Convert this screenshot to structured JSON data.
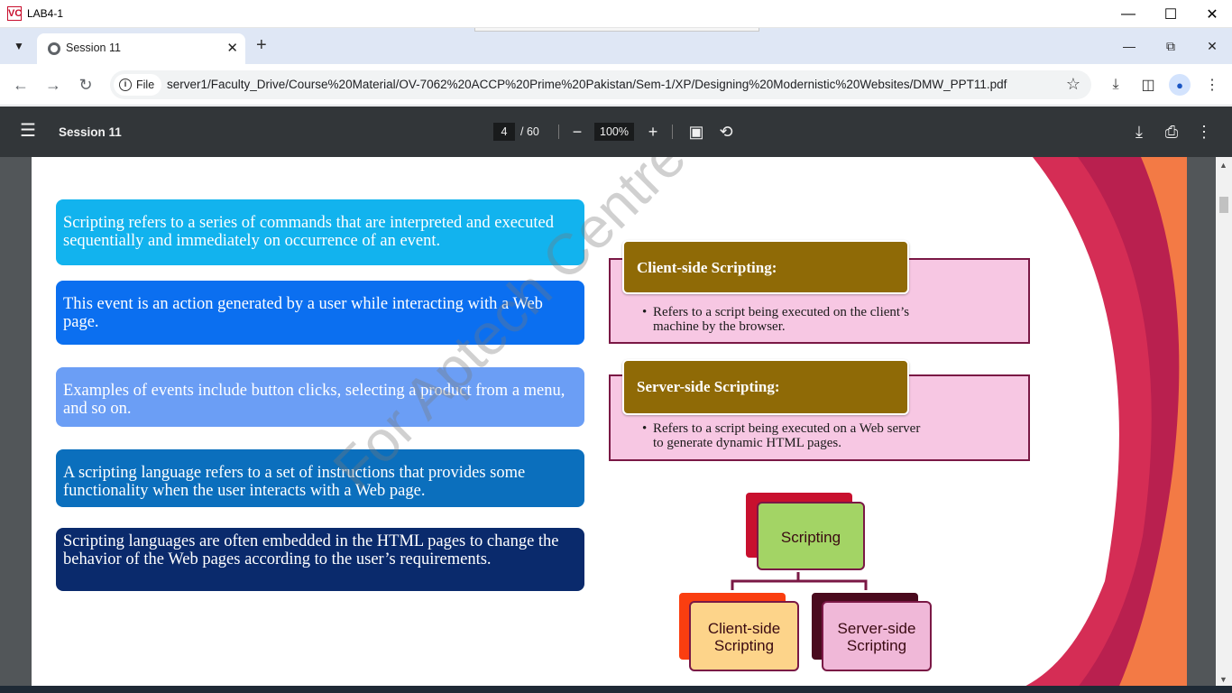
{
  "window": {
    "title": "LAB4-1",
    "logo_text": "VC"
  },
  "browser": {
    "tab_title": "Session 11",
    "url_chip": "File",
    "url": "server1/Faculty_Drive/Course%20Material/OV-7062%20ACCP%20Prime%20Pakistan/Sem-1/XP/Designing%20Modernistic%20Websites/DMW_PPT11.pdf"
  },
  "pdf_toolbar": {
    "title": "Session 11",
    "page_current": "4",
    "page_total": "/ 60",
    "zoom": "100%"
  },
  "slide": {
    "boxes": [
      {
        "text": "Scripting refers to a series of commands that are interpreted and executed sequentially and immediately on occurrence of an event.",
        "color": "#12b3ee"
      },
      {
        "text": "This event is an action generated by a user while interacting with a Web page.",
        "color": "#0b6ff0"
      },
      {
        "text": "Examples of events include button clicks, selecting a product from a menu, and so on.",
        "color": "#6b9ef5"
      },
      {
        "text": "A scripting language refers to a set of instructions that provides some functionality when the user interacts with a Web page.",
        "color": "#0b6fbd"
      },
      {
        "text": "Scripting languages are often embedded in the HTML pages to change the behavior of the Web pages according to the user’s requirements.",
        "color": "#0a2a6c"
      }
    ],
    "client": {
      "heading": "Client-side Scripting:",
      "line1": "Refers to a script being executed on the client’s",
      "line2": "machine by the browser."
    },
    "server": {
      "heading": "Server-side Scripting:",
      "line1": "Refers to a script being executed on a Web server",
      "line2": "to generate dynamic HTML pages."
    },
    "diagram": {
      "root": "Scripting",
      "left_line1": "Client-side",
      "left_line2": "Scripting",
      "right_line1": "Server-side",
      "right_line2": "Scripting"
    },
    "watermark": "For Aptech Centre Use Only"
  }
}
